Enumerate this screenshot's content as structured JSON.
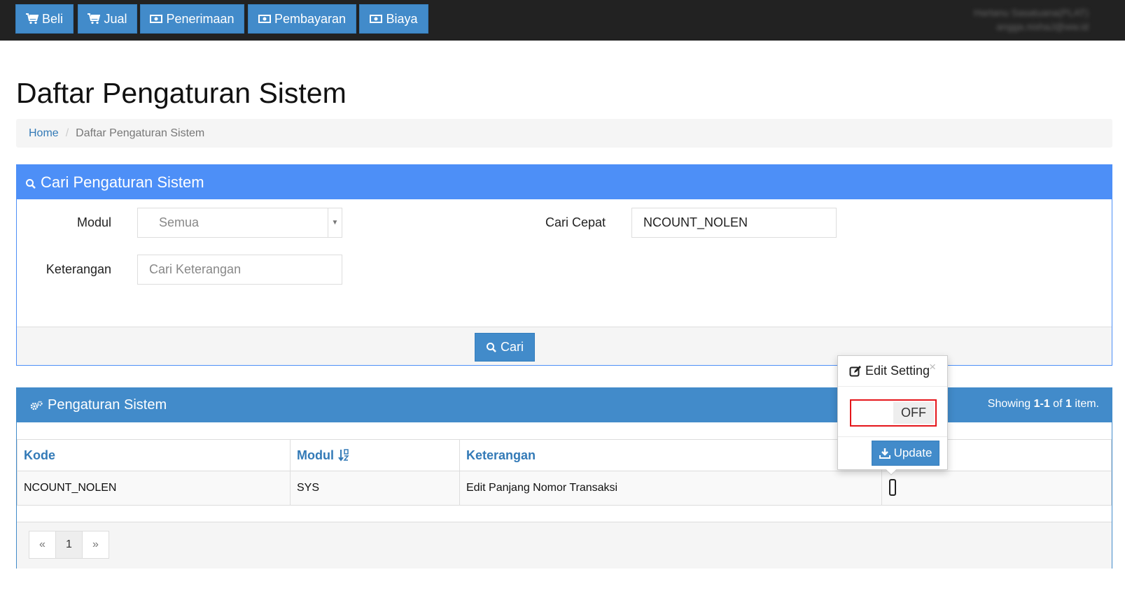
{
  "topnav": {
    "buttons": [
      {
        "label": "Beli",
        "icon": "cart-icon"
      },
      {
        "label": "Jual",
        "icon": "cart-icon"
      },
      {
        "label": "Penerimaan",
        "icon": "money-icon"
      },
      {
        "label": "Pembayaran",
        "icon": "money-icon"
      },
      {
        "label": "Biaya",
        "icon": "money-icon"
      }
    ],
    "user_name": "Hartanu Sasatuana(PLAT)",
    "user_email": "angga.nishaJ@ww.id"
  },
  "page_title": "Daftar Pengaturan Sistem",
  "breadcrumb": {
    "home": "Home",
    "separator": "/",
    "current": "Daftar Pengaturan Sistem"
  },
  "search_panel": {
    "title": "Cari Pengaturan Sistem",
    "modul_label": "Modul",
    "modul_value": "Semua",
    "keterangan_label": "Keterangan",
    "keterangan_placeholder": "Cari Keterangan",
    "cari_cepat_label": "Cari Cepat",
    "cari_cepat_value": "NCOUNT_NOLEN",
    "search_button": "Cari"
  },
  "results_panel": {
    "title": "Pengaturan Sistem",
    "summary_prefix": "Showing ",
    "summary_range": "1-1",
    "summary_mid": " of ",
    "summary_total": "1",
    "summary_suffix": " item.",
    "columns": [
      "Kode",
      "Modul",
      "Keterangan"
    ],
    "rows": [
      {
        "kode": "NCOUNT_NOLEN",
        "modul": "SYS",
        "keterangan": "Edit Panjang Nomor Transaksi"
      }
    ],
    "pagination": {
      "prev": "«",
      "current": "1",
      "next": "»"
    }
  },
  "popover": {
    "title": "Edit Setting",
    "close": "×",
    "toggle_state": "OFF",
    "update_button": "Update"
  },
  "colors": {
    "topbar": "#222222",
    "primary": "#428bca",
    "search_header": "#4d8ff7",
    "highlight_border": "#e5161b"
  }
}
